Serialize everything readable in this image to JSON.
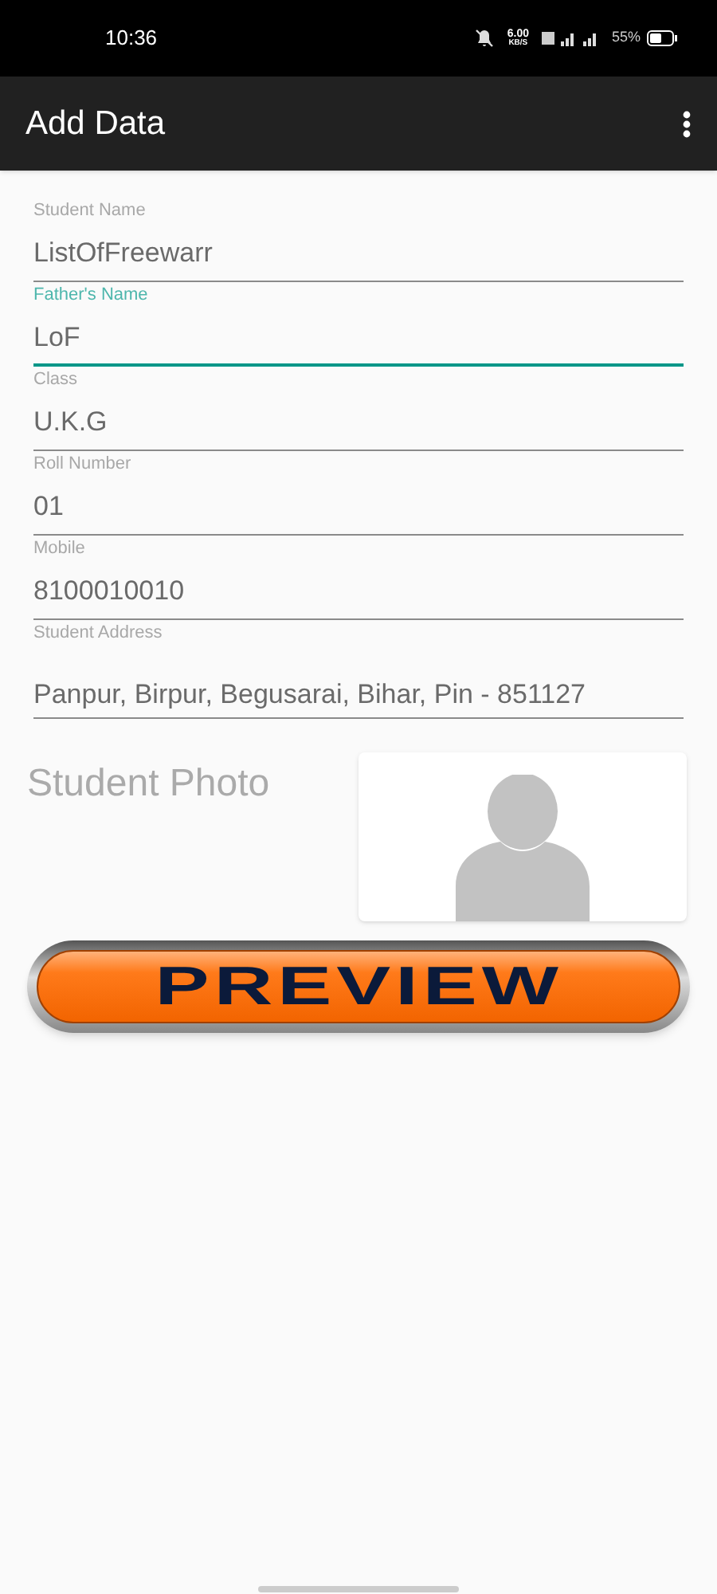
{
  "status_bar": {
    "time": "10:36",
    "speed": "6.00",
    "speed_unit": "KB/S",
    "battery": "55%"
  },
  "app_bar": {
    "title": "Add Data"
  },
  "fields": [
    {
      "label": "Student Name",
      "value": "ListOfFreewarr",
      "focused": false
    },
    {
      "label": "Father's Name",
      "value": "LoF",
      "focused": true
    },
    {
      "label": "Class",
      "value": "U.K.G",
      "focused": false
    },
    {
      "label": "Roll Number",
      "value": "01",
      "focused": false
    },
    {
      "label": "Mobile",
      "value": "8100010010",
      "focused": false
    },
    {
      "label": "Student Address",
      "value": "Panpur, Birpur, Begusarai, Bihar, Pin - 851127",
      "focused": false
    }
  ],
  "photo": {
    "label": "Student Photo"
  },
  "preview_button": {
    "label": "PREVIEW"
  }
}
